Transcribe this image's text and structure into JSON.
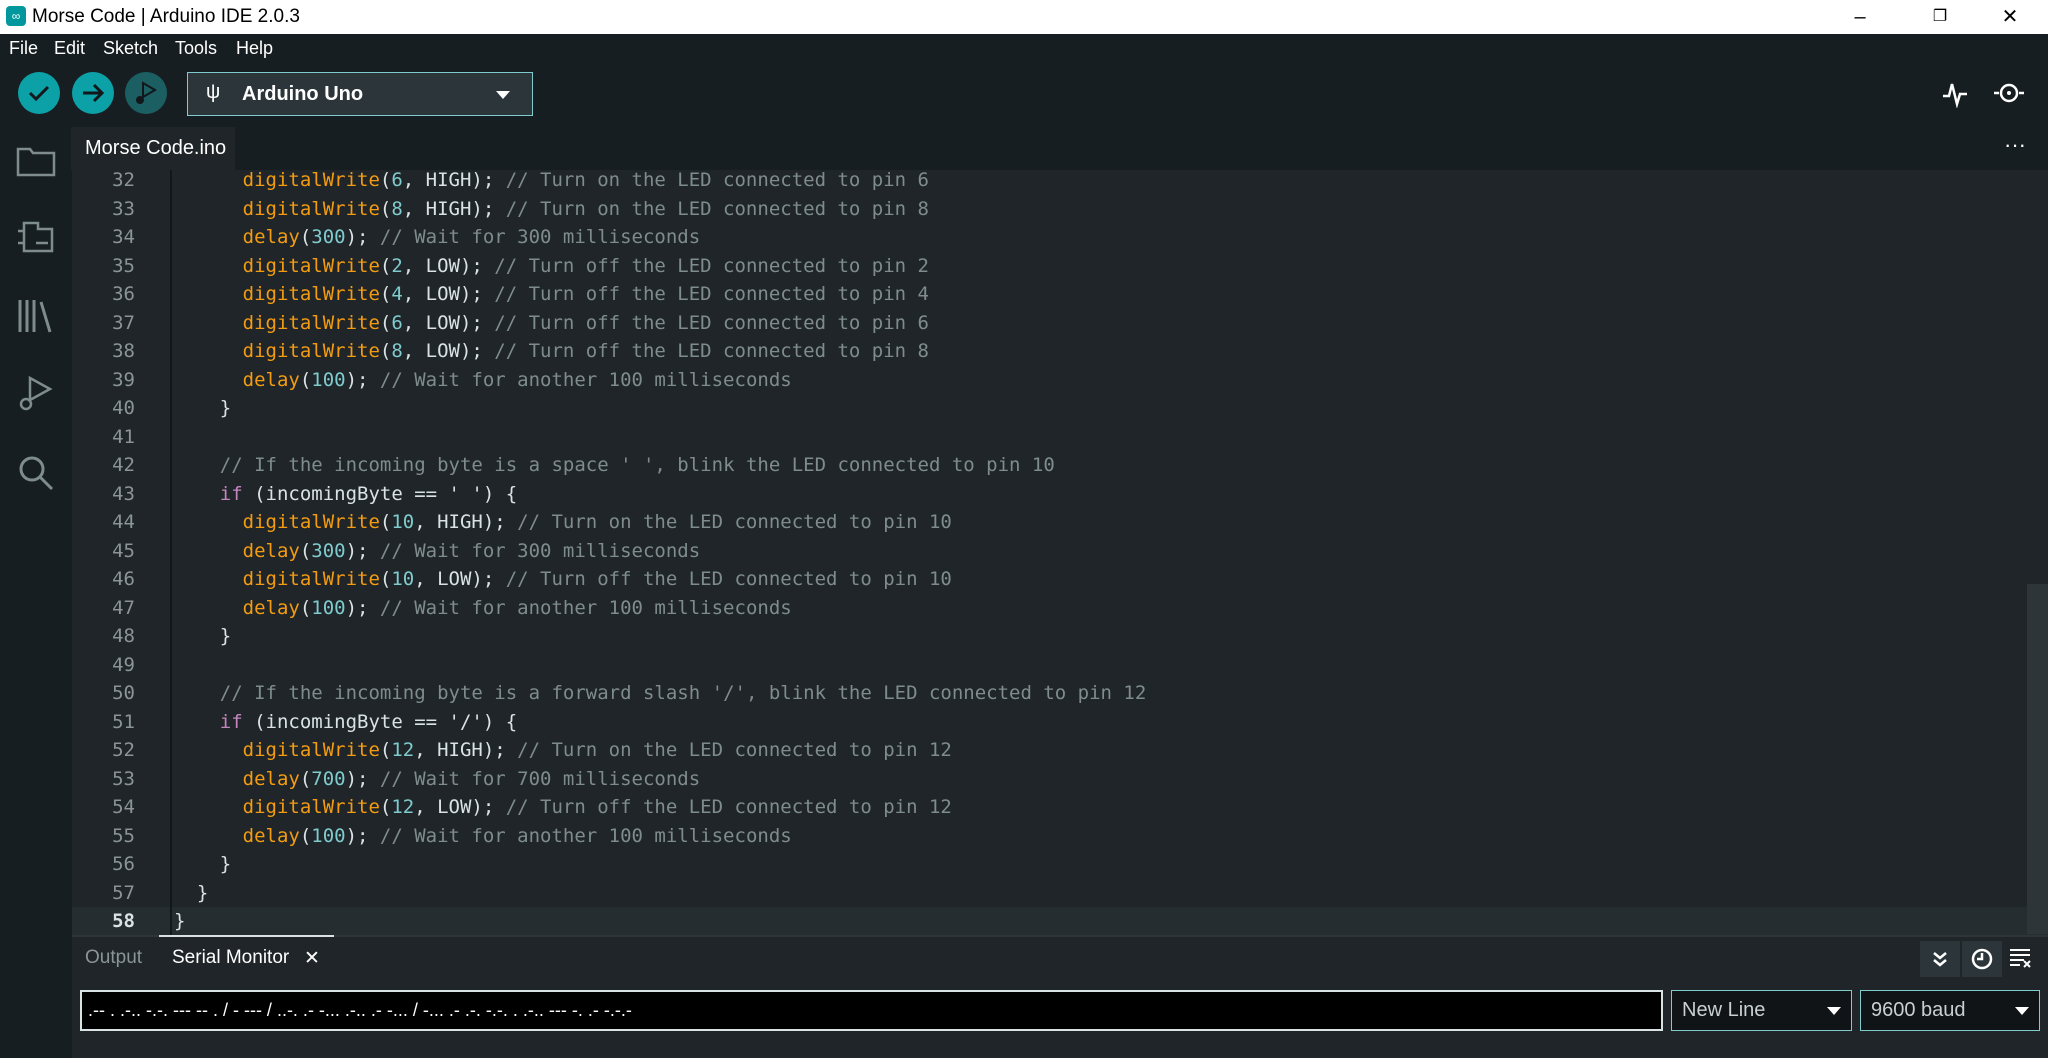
{
  "window": {
    "title": "Morse Code | Arduino IDE 2.0.3",
    "logo": "∞",
    "minimize": "–",
    "maximize": "❐",
    "close": "✕"
  },
  "menu": [
    "File",
    "Edit",
    "Sketch",
    "Tools",
    "Help"
  ],
  "toolbar": {
    "board": "Arduino Uno",
    "accent": "#0ca1a6"
  },
  "file_tab": "Morse Code.ino",
  "more": "···",
  "editor": {
    "current_line": 58,
    "lines": [
      {
        "n": 32,
        "t": "      digitalWrite(6, HIGH); // Turn on the LED connected to pin 6"
      },
      {
        "n": 33,
        "t": "      digitalWrite(8, HIGH); // Turn on the LED connected to pin 8"
      },
      {
        "n": 34,
        "t": "      delay(300); // Wait for 300 milliseconds"
      },
      {
        "n": 35,
        "t": "      digitalWrite(2, LOW); // Turn off the LED connected to pin 2"
      },
      {
        "n": 36,
        "t": "      digitalWrite(4, LOW); // Turn off the LED connected to pin 4"
      },
      {
        "n": 37,
        "t": "      digitalWrite(6, LOW); // Turn off the LED connected to pin 6"
      },
      {
        "n": 38,
        "t": "      digitalWrite(8, LOW); // Turn off the LED connected to pin 8"
      },
      {
        "n": 39,
        "t": "      delay(100); // Wait for another 100 milliseconds"
      },
      {
        "n": 40,
        "t": "    }"
      },
      {
        "n": 41,
        "t": ""
      },
      {
        "n": 42,
        "t": "    // If the incoming byte is a space ' ', blink the LED connected to pin 10"
      },
      {
        "n": 43,
        "t": "    if (incomingByte == ' ') {"
      },
      {
        "n": 44,
        "t": "      digitalWrite(10, HIGH); // Turn on the LED connected to pin 10"
      },
      {
        "n": 45,
        "t": "      delay(300); // Wait for 300 milliseconds"
      },
      {
        "n": 46,
        "t": "      digitalWrite(10, LOW); // Turn off the LED connected to pin 10"
      },
      {
        "n": 47,
        "t": "      delay(100); // Wait for another 100 milliseconds"
      },
      {
        "n": 48,
        "t": "    }"
      },
      {
        "n": 49,
        "t": ""
      },
      {
        "n": 50,
        "t": "    // If the incoming byte is a forward slash '/', blink the LED connected to pin 12"
      },
      {
        "n": 51,
        "t": "    if (incomingByte == '/') {"
      },
      {
        "n": 52,
        "t": "      digitalWrite(12, HIGH); // Turn on the LED connected to pin 12"
      },
      {
        "n": 53,
        "t": "      delay(700); // Wait for 700 milliseconds"
      },
      {
        "n": 54,
        "t": "      digitalWrite(12, LOW); // Turn off the LED connected to pin 12"
      },
      {
        "n": 55,
        "t": "      delay(100); // Wait for another 100 milliseconds"
      },
      {
        "n": 56,
        "t": "    }"
      },
      {
        "n": 57,
        "t": "  }"
      },
      {
        "n": 58,
        "t": "}"
      }
    ]
  },
  "panel": {
    "tabs": [
      "Output",
      "Serial Monitor"
    ],
    "close": "✕",
    "serial_input": ".-- . .-.. -.-. --- -- . / - --- / ..-. .- -... .-.. .- -... / -... .- .-. -.-. . .-.. --- -. .- -.-.-",
    "line_ending": "New Line",
    "baud": "9600 baud"
  }
}
